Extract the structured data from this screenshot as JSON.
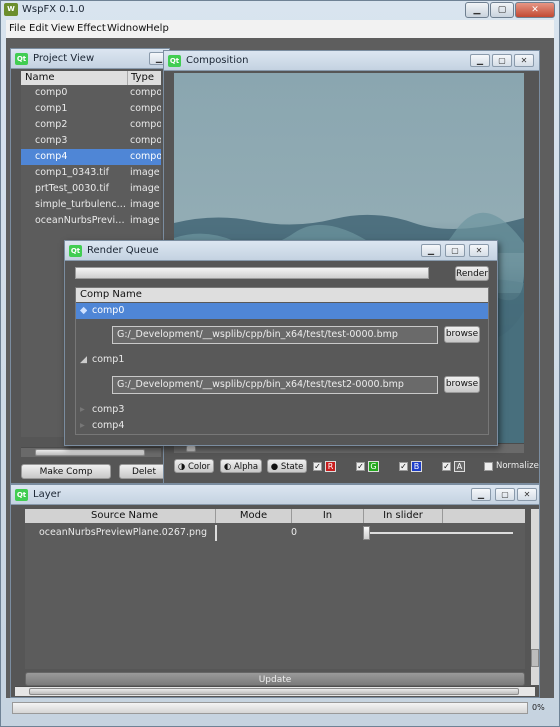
{
  "app": {
    "title": "WspFX 0.1.0",
    "logo": "qt-logo",
    "min": "▁",
    "max": "▢",
    "close": "✕"
  },
  "menu": [
    "File",
    "Edit",
    "View",
    "Effect",
    "Widnow",
    "Help"
  ],
  "project_view": {
    "title": "Project View",
    "columns": [
      "Name",
      "Type"
    ],
    "rows": [
      {
        "name": "comp0",
        "type": "compos"
      },
      {
        "name": "comp1",
        "type": "compos"
      },
      {
        "name": "comp2",
        "type": "compos"
      },
      {
        "name": "comp3",
        "type": "compos"
      },
      {
        "name": "comp4",
        "type": "compos"
      },
      {
        "name": "comp1_0343.tif",
        "type": "image s"
      },
      {
        "name": "prtTest_0030.tif",
        "type": "image s"
      },
      {
        "name": "simple_turbulenc…",
        "type": "image s"
      },
      {
        "name": "oceanNurbsPrevi…",
        "type": "image s"
      }
    ],
    "selected_index": 4,
    "make_comp": "Make Comp",
    "delete": "Delet"
  },
  "composition": {
    "title": "Composition",
    "toolbar": {
      "color": "Color",
      "alpha": "Alpha",
      "state": "State",
      "r": "R",
      "g": "G",
      "b": "B",
      "a": "A",
      "normalize": "Normalize"
    },
    "colors": {
      "r": "#c81e1e",
      "g": "#24a81e",
      "b": "#1e3fc8",
      "a": "#666666"
    }
  },
  "render_queue": {
    "title": "Render Queue",
    "render_button": "Render",
    "column": "Comp Name",
    "items": [
      {
        "name": "comp0",
        "path": "G:/_Development/__wsplib/cpp/bin_x64/test/test-0000.bmp",
        "browse": "browse"
      },
      {
        "name": "comp1",
        "path": "G:/_Development/__wsplib/cpp/bin_x64/test/test2-0000.bmp",
        "browse": "browse"
      },
      {
        "name": "comp3"
      },
      {
        "name": "comp4"
      }
    ]
  },
  "layer": {
    "title": "Layer",
    "columns": [
      "Source Name",
      "Mode",
      "In",
      "In slider"
    ],
    "rows": [
      {
        "source": "oceanNurbsPreviewPlane.0267.png",
        "mode": "",
        "in": "0"
      }
    ],
    "update": "Update"
  },
  "status": {
    "progress_text": "0%",
    "progress": 0
  }
}
